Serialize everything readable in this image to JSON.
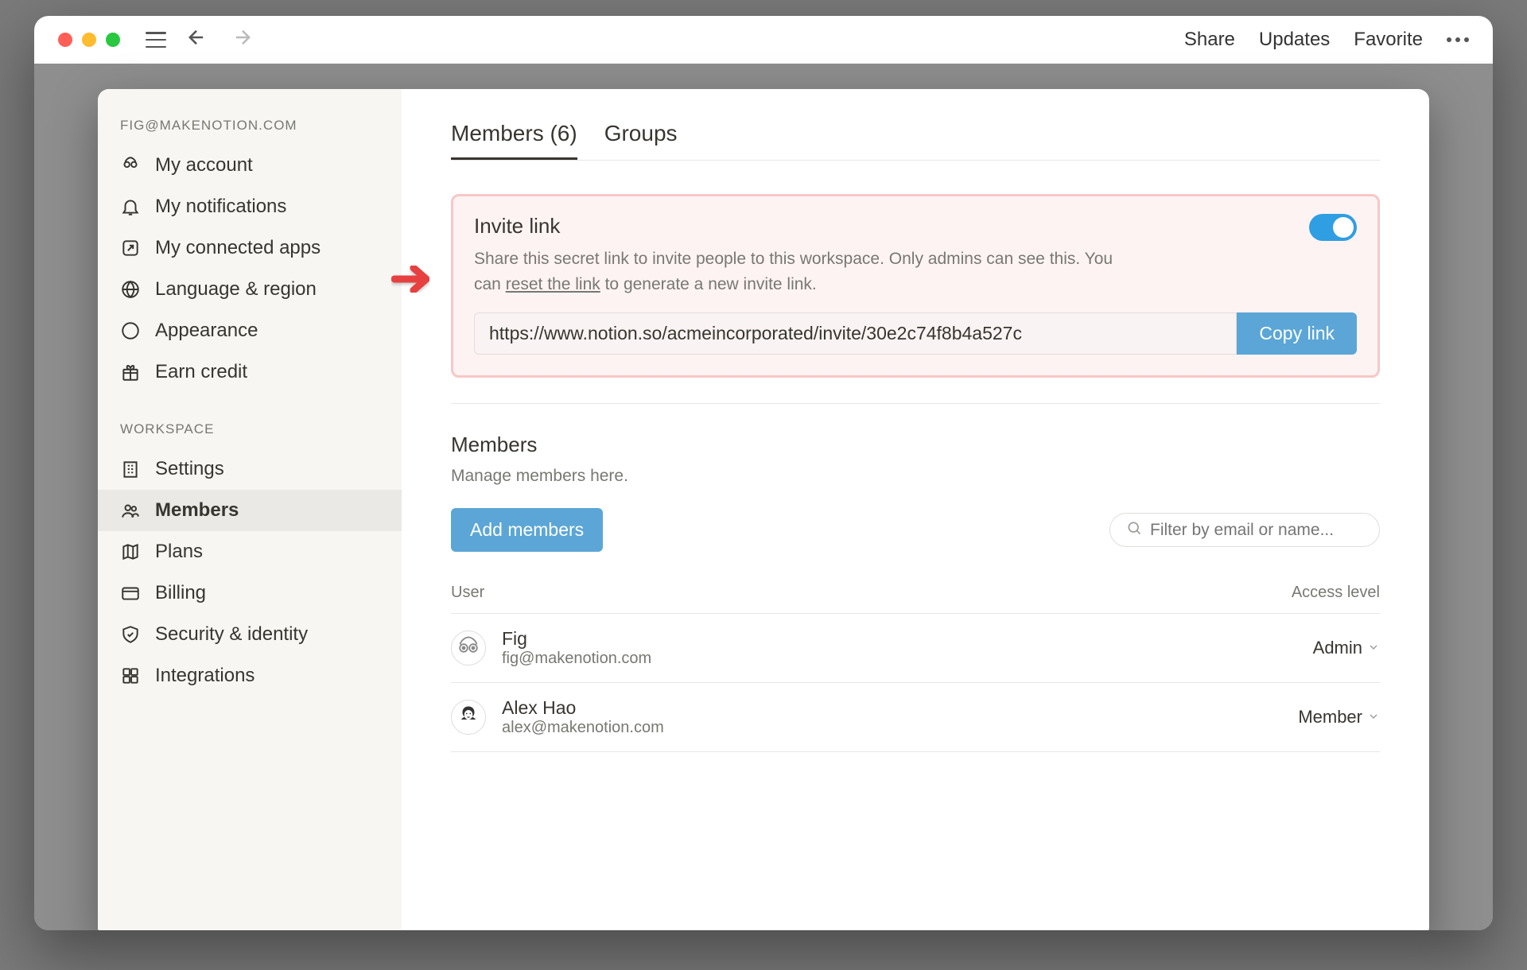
{
  "titlebar": {
    "share": "Share",
    "updates": "Updates",
    "favorite": "Favorite"
  },
  "sidebar": {
    "account_header": "FIG@MAKENOTION.COM",
    "workspace_header": "WORKSPACE",
    "items": [
      {
        "label": "My account"
      },
      {
        "label": "My notifications"
      },
      {
        "label": "My connected apps"
      },
      {
        "label": "Language & region"
      },
      {
        "label": "Appearance"
      },
      {
        "label": "Earn credit"
      }
    ],
    "ws_items": [
      {
        "label": "Settings"
      },
      {
        "label": "Members"
      },
      {
        "label": "Plans"
      },
      {
        "label": "Billing"
      },
      {
        "label": "Security & identity"
      },
      {
        "label": "Integrations"
      }
    ]
  },
  "tabs": {
    "members": "Members (6)",
    "groups": "Groups"
  },
  "invite": {
    "title": "Invite link",
    "desc_1": "Share this secret link to invite people to this workspace. Only admins can see this. You can ",
    "reset": "reset the link",
    "desc_2": " to generate a new invite link.",
    "url": "https://www.notion.so/acmeincorporated/invite/30e2c74f8b4a527c",
    "copy": "Copy link"
  },
  "members": {
    "title": "Members",
    "sub": "Manage members here.",
    "add": "Add members",
    "filter_placeholder": "Filter by email or name...",
    "col_user": "User",
    "col_access": "Access level",
    "rows": [
      {
        "name": "Fig",
        "email": "fig@makenotion.com",
        "access": "Admin"
      },
      {
        "name": "Alex Hao",
        "email": "alex@makenotion.com",
        "access": "Member"
      }
    ]
  }
}
